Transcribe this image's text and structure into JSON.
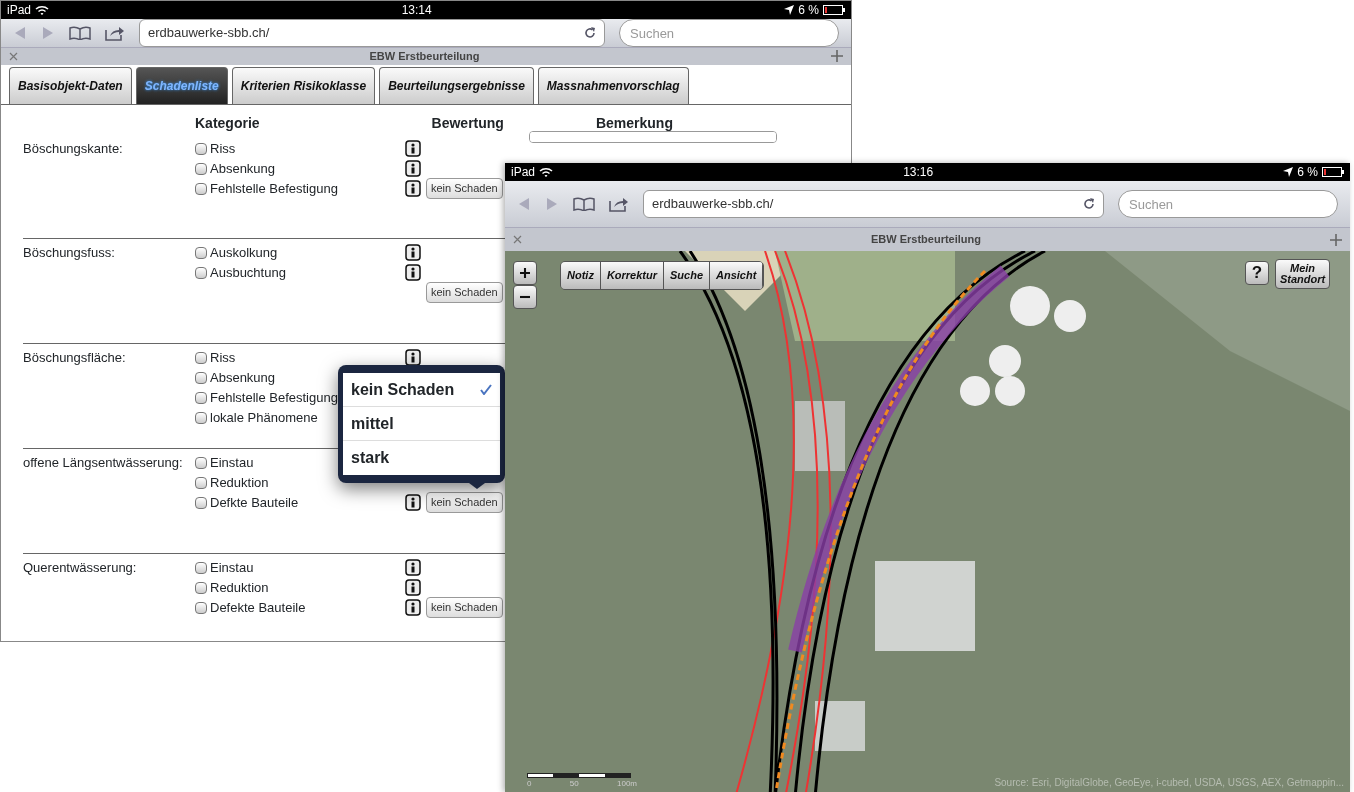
{
  "windows": [
    {
      "kind": "form",
      "status_bar": {
        "carrier": "iPad",
        "time": "13:14",
        "battery": "6 %"
      },
      "browser": {
        "url": "erdbauwerke-sbb.ch/",
        "search_placeholder": "Suchen",
        "page_title": "EBW Erstbeurteilung"
      },
      "tabs": [
        {
          "label": "Basisobjekt-Daten",
          "selected": false
        },
        {
          "label": "Schadenliste",
          "selected": true
        },
        {
          "label": "Kriterien Risikoklasse",
          "selected": false
        },
        {
          "label": "Beurteilungsergebnisse",
          "selected": false
        },
        {
          "label": "Massnahmenvorschlag",
          "selected": false
        }
      ],
      "form": {
        "columns": [
          "Kategorie",
          "Bewertung",
          "Bemerkung"
        ],
        "sections": [
          {
            "label": "Böschungskante:",
            "remark_field": true,
            "items": [
              {
                "label": "Riss",
                "checked": false
              },
              {
                "label": "Absenkung",
                "checked": false
              },
              {
                "label": "Fehlstelle Befestigung",
                "checked": false,
                "rating": "kein Schaden"
              }
            ]
          },
          {
            "label": "Böschungsfuss:",
            "items": [
              {
                "label": "Auskolkung",
                "checked": false
              },
              {
                "label": "Ausbuchtung",
                "checked": false
              }
            ],
            "rating": "kein Schaden"
          },
          {
            "label": "Böschungsfläche:",
            "items": [
              {
                "label": "Riss",
                "checked": false
              },
              {
                "label": "Absenkung",
                "checked": false
              },
              {
                "label": "Fehlstelle Befestigung",
                "checked": false
              },
              {
                "label": "lokale Phänomene",
                "checked": false
              }
            ]
          },
          {
            "label": "offene Längsentwässerung:",
            "items": [
              {
                "label": "Einstau",
                "checked": false
              },
              {
                "label": "Reduktion",
                "checked": false
              },
              {
                "label": "Defkte Bauteile",
                "checked": false,
                "rating": "kein Schaden"
              }
            ],
            "popover": [
              {
                "label": "kein Schaden",
                "selected": true
              },
              {
                "label": "mittel",
                "selected": false
              },
              {
                "label": "stark",
                "selected": false
              }
            ]
          },
          {
            "label": "Querentwässerung:",
            "items": [
              {
                "label": "Einstau",
                "checked": false
              },
              {
                "label": "Reduktion",
                "checked": false
              },
              {
                "label": "Defekte Bauteile",
                "checked": false,
                "rating": "kein Schaden"
              }
            ]
          }
        ]
      }
    },
    {
      "kind": "map",
      "status_bar": {
        "carrier": "iPad",
        "time": "13:16",
        "battery": "6 %"
      },
      "browser": {
        "url": "erdbauwerke-sbb.ch/",
        "search_placeholder": "Suchen",
        "page_title": "EBW Erstbeurteilung"
      },
      "map": {
        "tools": [
          "Notiz",
          "Korrektur",
          "Suche",
          "Ansicht"
        ],
        "help": "?",
        "locate": "Mein Standort",
        "scale_labels": [
          "0",
          "50",
          "100m"
        ],
        "attribution": "Source: Esri, DigitalGlobe, GeoEye, i-cubed, USDA, USGS, AEX, Getmappin..."
      }
    }
  ]
}
